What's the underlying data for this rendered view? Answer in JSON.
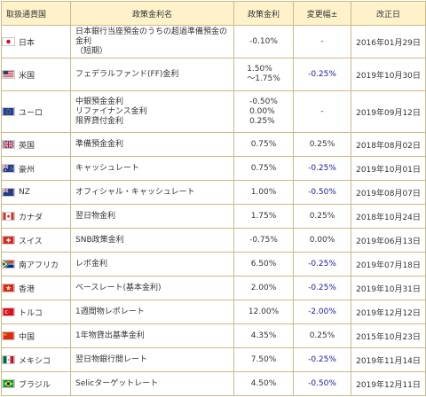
{
  "headers": {
    "country": "取扱通貨国",
    "policy": "政策金利名",
    "rate": "政策金利",
    "change": "変更幅±",
    "date": "改正日"
  },
  "rows": [
    {
      "country": "日本",
      "flag": "japan-flag-icon",
      "policy": "日本銀行当座預金のうちの超過準備預金の金利\n（短期）",
      "rate": "-0.10%",
      "change": "-",
      "date": "2016年01月29日"
    },
    {
      "country": "米国",
      "flag": "usa-flag-icon",
      "policy": "フェデラルファンド(FF)金利",
      "rate": "1.50%\n～1.75%",
      "change": "-0.25%",
      "date": "2019年10月30日"
    },
    {
      "country": "ユーロ",
      "flag": "eu-flag-icon",
      "policy": "中銀預金金利\nリファイナンス金利\n限界貸付金利",
      "rate": "-0.50%\n0.00%\n0.25%",
      "change": "-",
      "date": "2019年09月12日"
    },
    {
      "country": "英国",
      "flag": "uk-flag-icon",
      "policy": "準備預金金利",
      "rate": "0.75%",
      "change": "0.25%",
      "date": "2018年08月02日"
    },
    {
      "country": "豪州",
      "flag": "australia-flag-icon",
      "policy": "キャッシュレート",
      "rate": "0.75%",
      "change": "-0.25%",
      "date": "2019年10月01日"
    },
    {
      "country": "NZ",
      "flag": "new-zealand-flag-icon",
      "policy": "オフィシャル・キャッシュレート",
      "rate": "1.00%",
      "change": "-0.50%",
      "date": "2019年08月07日"
    },
    {
      "country": "カナダ",
      "flag": "canada-flag-icon",
      "policy": "翌日物金利",
      "rate": "1.75%",
      "change": "0.25%",
      "date": "2018年10月24日"
    },
    {
      "country": "スイス",
      "flag": "switzerland-flag-icon",
      "policy": "SNB政策金利",
      "rate": "-0.75%",
      "change": "0.00%",
      "date": "2019年06月13日"
    },
    {
      "country": "南アフリカ",
      "flag": "south-africa-flag-icon",
      "policy": "レポ金利",
      "rate": "6.50%",
      "change": "-0.25%",
      "date": "2019年07月18日"
    },
    {
      "country": "香港",
      "flag": "hong-kong-flag-icon",
      "policy": "ベースレート(基本金利)",
      "rate": "2.00%",
      "change": "-0.25%",
      "date": "2019年10月31日"
    },
    {
      "country": "トルコ",
      "flag": "turkey-flag-icon",
      "policy": "1週間物レポレート",
      "rate": "12.00%",
      "change": "-2.00%",
      "date": "2019年12月12日"
    },
    {
      "country": "中国",
      "flag": "china-flag-icon",
      "policy": "1年物貸出基準金利",
      "rate": "4.35%",
      "change": "0.25%",
      "date": "2015年10月23日"
    },
    {
      "country": "メキシコ",
      "flag": "mexico-flag-icon",
      "policy": "翌日物銀行間レート",
      "rate": "7.50%",
      "change": "-0.25%",
      "date": "2019年11月14日"
    },
    {
      "country": "ブラジル",
      "flag": "brazil-flag-icon",
      "policy": "Selicターゲットレート",
      "rate": "4.50%",
      "change": "-0.50%",
      "date": "2019年12月11日"
    }
  ],
  "colors": {
    "header_bg": "#fdf2c9",
    "border": "#cdb98a",
    "negative_change": "#1a1a9e",
    "text": "#333333"
  }
}
